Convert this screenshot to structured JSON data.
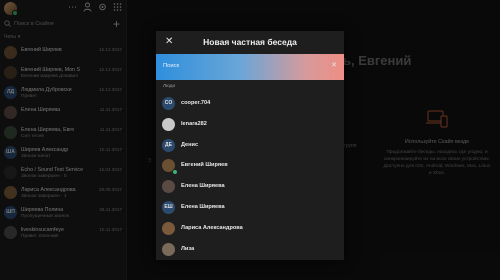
{
  "sidebar": {
    "search_placeholder": "Поиск в Скайпе",
    "section_label": "Чаты",
    "contacts": [
      {
        "name": "Евгений Ширяев",
        "date": "12.12.2017",
        "preview": "",
        "initials": "",
        "color": "#6b4f33"
      },
      {
        "name": "Евгений Ширяев, Mon S",
        "date": "12.12.2017",
        "preview": "Евгений Ширяев добавил",
        "initials": "",
        "color": "#4a3a2a"
      },
      {
        "name": "Людмила Дубровски",
        "date": "12.12.2017",
        "preview": "Привет",
        "initials": "ЛД",
        "color": "#2b4a6e"
      },
      {
        "name": "Елена Ширяева",
        "date": "11.11.2017",
        "preview": "",
        "initials": "",
        "color": "#5a4a44"
      },
      {
        "name": "Елена Ширяева, Евге",
        "date": "11.11.2017",
        "preview": "Сил тесей",
        "initials": "",
        "color": "#3a4a3a"
      },
      {
        "name": "Ширяев Александр",
        "date": "10.11.2017",
        "preview": "Звонок начат",
        "initials": "ША",
        "color": "#2b4a6e"
      },
      {
        "name": "Echo / Sound Test Service",
        "date": "12.04.2017",
        "preview": "Звонок завершен · 0",
        "initials": "",
        "color": "#2a2a2a"
      },
      {
        "name": "Лариса Александрова",
        "date": "29.05.2017",
        "preview": "Звонок завершен · 1",
        "initials": "",
        "color": "#7a5a3a"
      },
      {
        "name": "Ширяева Полина",
        "date": "26.11.2017",
        "preview": "Пропущенный звонок",
        "initials": "ШП",
        "color": "#2b4a6e"
      },
      {
        "name": "liveskinsucamfeye",
        "date": "10.11.2017",
        "preview": "Привет, Евгений!",
        "initials": "",
        "color": "#4a4a4a"
      }
    ]
  },
  "main": {
    "greeting": "ь, Евгений",
    "side_title": "Используйте Скайп везде",
    "side_desc": "Продолжайте беседы, находясь где угодно, и синхронизируйте их на всех своих устройствах. Доступно для iOS, Android, Windows, Mac, Linux и Xbox.",
    "left_stub": "групп",
    "left_stub2": "З"
  },
  "modal": {
    "title": "Новая частная беседа",
    "close_glyph": "✕",
    "clear_glyph": "✕",
    "search_placeholder": "Поиск",
    "section_label": "Люди",
    "people": [
      {
        "name": "cooper.704",
        "initials": "CO",
        "color": "#2b4a6e",
        "online": false
      },
      {
        "name": "lenara282",
        "initials": "",
        "color": "#c8c8c8",
        "online": false
      },
      {
        "name": "Денис",
        "initials": "ДЕ",
        "color": "#2b4a6e",
        "online": false
      },
      {
        "name": "Евгений Ширяев",
        "initials": "",
        "color": "#6b4f33",
        "online": true
      },
      {
        "name": "Елена Ширяева",
        "initials": "",
        "color": "#5a4a44",
        "online": false
      },
      {
        "name": "Елена Ширяева",
        "initials": "ЕШ",
        "color": "#2b4a6e",
        "online": false
      },
      {
        "name": "Лариса Александрова",
        "initials": "",
        "color": "#7a5a3a",
        "online": false
      },
      {
        "name": "Лиза",
        "initials": "",
        "color": "#7a6a5a",
        "online": false
      }
    ]
  }
}
